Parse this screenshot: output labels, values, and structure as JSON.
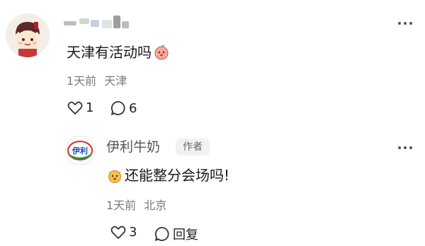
{
  "comment": {
    "username_redacted": true,
    "text": "天津有活动吗",
    "emoji": "peach-face-emoji",
    "time": "1天前",
    "location": "天津",
    "likes": "1",
    "replies": "6"
  },
  "reply": {
    "author_name": "伊利牛奶",
    "author_badge": "作者",
    "logo_text": "伊利",
    "emoji": "fox-face-emoji",
    "text": "还能整分会场吗!",
    "time": "1天前",
    "location": "北京",
    "likes": "3",
    "reply_label": "回复"
  },
  "colors": {
    "text_primary": "#191919",
    "text_meta": "#7a7a7a",
    "badge_bg": "#f2f2f2",
    "logo_red": "#d9302c",
    "logo_green": "#1f9a3a"
  }
}
